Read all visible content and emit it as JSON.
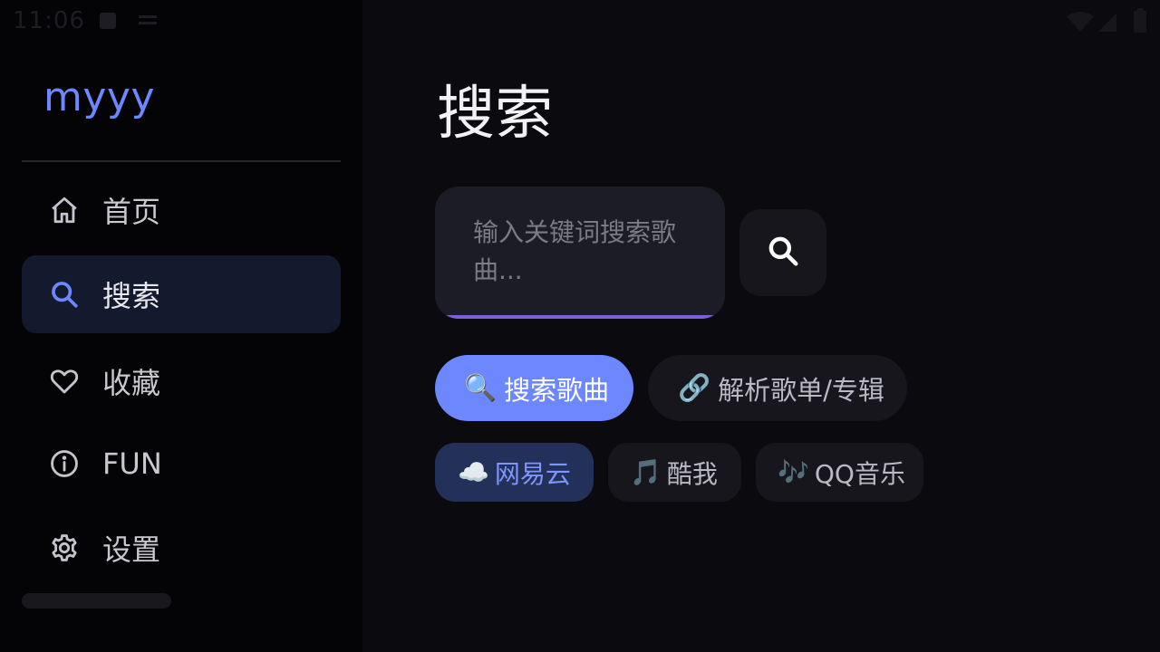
{
  "status_bar": {
    "time": "11:06",
    "icons": [
      "notification-icon",
      "sim-icon",
      "wifi-icon",
      "cellular-icon",
      "battery-icon"
    ]
  },
  "app": {
    "name": "myyy"
  },
  "sidebar": {
    "items": [
      {
        "label": "首页",
        "icon": "home-icon",
        "active": false
      },
      {
        "label": "搜索",
        "icon": "search-icon",
        "active": true
      },
      {
        "label": "收藏",
        "icon": "heart-icon",
        "active": false
      },
      {
        "label": "FUN",
        "icon": "info-icon",
        "active": false
      },
      {
        "label": "设置",
        "icon": "gear-icon",
        "active": false
      }
    ]
  },
  "main": {
    "title": "搜索",
    "search": {
      "placeholder": "输入关键词搜索歌曲...",
      "value": ""
    },
    "modes": [
      {
        "emoji": "🔍",
        "label": "搜索歌曲",
        "selected": true
      },
      {
        "emoji": "🔗",
        "label": "解析歌单/专辑",
        "selected": false
      }
    ],
    "sources": [
      {
        "emoji": "☁️",
        "label": "网易云",
        "selected": true
      },
      {
        "emoji": "🎵",
        "label": "酷我",
        "selected": false
      },
      {
        "emoji": "🎶",
        "label": "QQ音乐",
        "selected": false
      }
    ]
  },
  "colors": {
    "accent": "#6d88ff",
    "active_nav_bg": "#141a2e",
    "input_underline": "#7d5fd9"
  }
}
